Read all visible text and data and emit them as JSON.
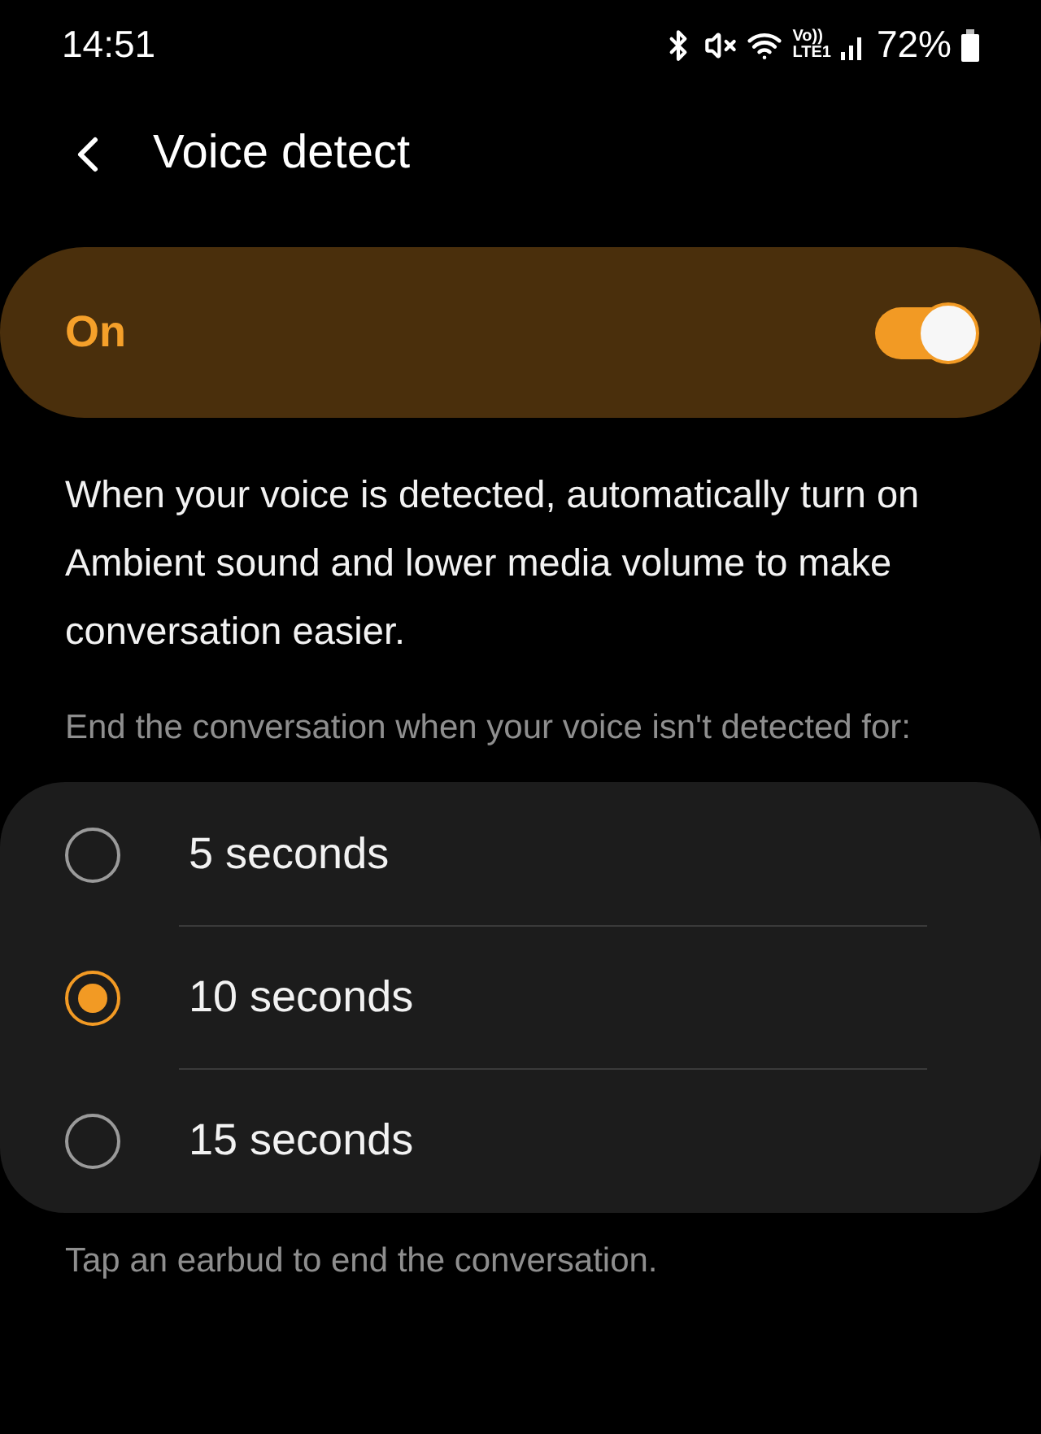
{
  "status_bar": {
    "time": "14:51",
    "volte": "Vo))",
    "network": "LTE1",
    "battery": "72%"
  },
  "header": {
    "title": "Voice detect"
  },
  "master_switch": {
    "label": "On",
    "on": true
  },
  "description": "When your voice is detected, automatically turn on Ambient sound and lower media volume to make conversation easier.",
  "options_label": "End the conversation when your voice isn't detected for:",
  "options": [
    {
      "label": "5 seconds",
      "selected": false
    },
    {
      "label": "10 seconds",
      "selected": true
    },
    {
      "label": "15 seconds",
      "selected": false
    }
  ],
  "footer": "Tap an earbud to end the conversation."
}
